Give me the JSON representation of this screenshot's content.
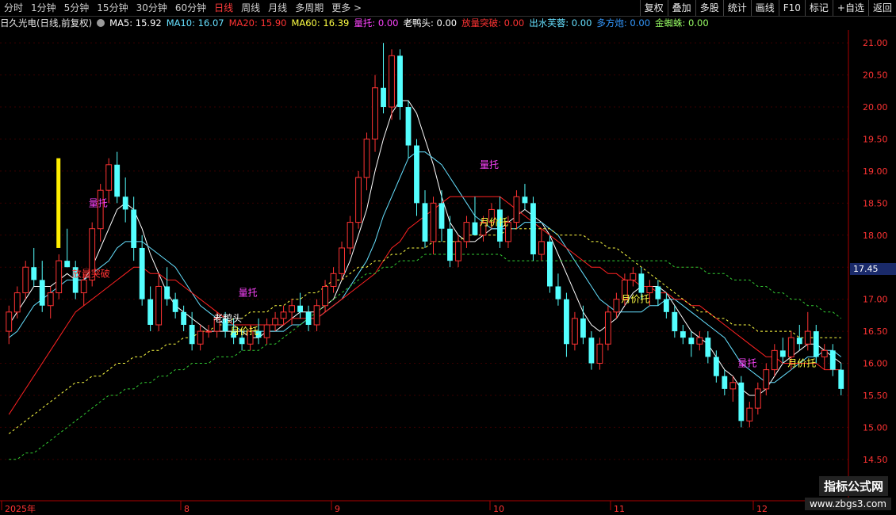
{
  "toolbar": {
    "periods": [
      "分时",
      "1分钟",
      "5分钟",
      "15分钟",
      "30分钟",
      "60分钟",
      "日线",
      "周线",
      "月线",
      "多周期",
      "更多 >"
    ],
    "active_period": "日线",
    "right_buttons": [
      "复权",
      "叠加",
      "多股",
      "统计",
      "画线",
      "F10",
      "标记",
      "+自选",
      "返回"
    ]
  },
  "info": {
    "stock": "日久光电(日线,前复权)",
    "ma5": "MA5: 15.92",
    "ma10": "MA10: 16.07",
    "ma20": "MA20: 15.90",
    "ma60": "MA60: 16.39",
    "i1": "量托: 0.00",
    "i2": "老鸭头: 0.00",
    "i3": "放量突破: 0.00",
    "i4": "出水芙蓉: 0.00",
    "i5": "多方炮: 0.00",
    "i6": "金蜘蛛: 0.00",
    "colors": {
      "ma5": "#ffffff",
      "ma10": "#66e0ff",
      "ma20": "#ff3333",
      "ma60": "#ffff44",
      "i1": "#ff44ff",
      "i2": "#ffffff",
      "i3": "#ff3333",
      "i4": "#66e0ff",
      "i5": "#3399ff",
      "i6": "#99ff66"
    }
  },
  "current_price": "17.45",
  "chart_data": {
    "type": "candlestick",
    "ylim": [
      14.3,
      21.2
    ],
    "yticks": [
      "21.00",
      "20.50",
      "20.00",
      "19.50",
      "19.00",
      "18.50",
      "18.00",
      "17.50",
      "17.00",
      "16.50",
      "16.00",
      "15.50",
      "15.00",
      "14.50"
    ],
    "x_labels": [
      "2025年",
      "8",
      "9",
      "10",
      "11",
      "12"
    ],
    "candles": [
      [
        16.5,
        16.9,
        16.3,
        16.8
      ],
      [
        16.8,
        17.2,
        16.7,
        17.1
      ],
      [
        17.1,
        17.6,
        17.0,
        17.5
      ],
      [
        17.5,
        17.8,
        17.2,
        17.3
      ],
      [
        17.3,
        17.6,
        16.8,
        16.9
      ],
      [
        16.9,
        17.2,
        16.7,
        17.1
      ],
      [
        17.1,
        17.7,
        17.0,
        17.6
      ],
      [
        17.6,
        18.1,
        17.5,
        17.5
      ],
      [
        17.5,
        17.6,
        17.0,
        17.1
      ],
      [
        17.1,
        17.4,
        16.9,
        17.3
      ],
      [
        17.3,
        18.2,
        17.2,
        18.1
      ],
      [
        18.1,
        18.8,
        17.9,
        18.7
      ],
      [
        18.7,
        19.2,
        18.5,
        19.1
      ],
      [
        19.1,
        19.3,
        18.5,
        18.6
      ],
      [
        18.6,
        18.9,
        18.2,
        18.4
      ],
      [
        18.4,
        18.6,
        17.6,
        17.8
      ],
      [
        17.8,
        18.0,
        16.9,
        17.0
      ],
      [
        17.0,
        17.2,
        16.5,
        16.6
      ],
      [
        16.6,
        17.4,
        16.5,
        17.2
      ],
      [
        17.2,
        17.5,
        16.9,
        17.0
      ],
      [
        17.0,
        17.1,
        16.7,
        16.8
      ],
      [
        16.8,
        16.9,
        16.5,
        16.6
      ],
      [
        16.6,
        16.8,
        16.2,
        16.3
      ],
      [
        16.3,
        16.6,
        16.2,
        16.5
      ],
      [
        16.5,
        16.6,
        16.4,
        16.5
      ],
      [
        16.5,
        16.8,
        16.4,
        16.7
      ],
      [
        16.7,
        16.8,
        16.4,
        16.5
      ],
      [
        16.5,
        16.7,
        16.3,
        16.4
      ],
      [
        16.4,
        16.5,
        16.2,
        16.3
      ],
      [
        16.3,
        16.6,
        16.2,
        16.5
      ],
      [
        16.5,
        16.7,
        16.3,
        16.4
      ],
      [
        16.4,
        16.7,
        16.3,
        16.6
      ],
      [
        16.6,
        16.8,
        16.5,
        16.7
      ],
      [
        16.7,
        16.9,
        16.6,
        16.8
      ],
      [
        16.8,
        17.0,
        16.6,
        16.9
      ],
      [
        16.9,
        17.1,
        16.7,
        16.8
      ],
      [
        16.8,
        16.9,
        16.5,
        16.6
      ],
      [
        16.6,
        17.0,
        16.5,
        16.9
      ],
      [
        16.9,
        17.3,
        16.8,
        17.2
      ],
      [
        17.2,
        17.5,
        17.1,
        17.4
      ],
      [
        17.4,
        17.9,
        17.3,
        17.8
      ],
      [
        17.8,
        18.3,
        17.7,
        18.2
      ],
      [
        18.2,
        19.0,
        18.1,
        18.9
      ],
      [
        18.9,
        19.6,
        18.7,
        19.5
      ],
      [
        19.5,
        20.5,
        19.3,
        20.3
      ],
      [
        20.3,
        21.0,
        19.9,
        20.0
      ],
      [
        20.0,
        20.9,
        19.8,
        20.8
      ],
      [
        20.8,
        20.9,
        19.8,
        20.0
      ],
      [
        20.0,
        20.1,
        19.2,
        19.4
      ],
      [
        19.4,
        19.5,
        18.3,
        18.5
      ],
      [
        18.5,
        18.7,
        17.8,
        17.9
      ],
      [
        17.9,
        18.6,
        17.7,
        18.5
      ],
      [
        18.5,
        18.7,
        17.9,
        18.1
      ],
      [
        18.1,
        18.3,
        17.5,
        17.6
      ],
      [
        17.6,
        18.0,
        17.5,
        17.9
      ],
      [
        17.9,
        18.3,
        17.8,
        18.2
      ],
      [
        18.2,
        18.6,
        18.0,
        18.0
      ],
      [
        18.0,
        18.3,
        17.9,
        18.2
      ],
      [
        18.2,
        18.5,
        18.1,
        18.4
      ],
      [
        18.4,
        18.6,
        17.8,
        17.9
      ],
      [
        17.9,
        18.3,
        17.8,
        18.2
      ],
      [
        18.2,
        18.7,
        18.1,
        18.6
      ],
      [
        18.6,
        18.8,
        18.4,
        18.5
      ],
      [
        18.5,
        18.6,
        17.6,
        17.7
      ],
      [
        17.7,
        18.1,
        17.6,
        17.9
      ],
      [
        17.9,
        18.0,
        17.1,
        17.2
      ],
      [
        17.2,
        17.4,
        16.9,
        17.0
      ],
      [
        17.0,
        17.1,
        16.1,
        16.3
      ],
      [
        16.3,
        16.8,
        16.2,
        16.7
      ],
      [
        16.7,
        16.9,
        16.3,
        16.4
      ],
      [
        16.4,
        16.5,
        15.9,
        16.0
      ],
      [
        16.0,
        16.4,
        15.9,
        16.3
      ],
      [
        16.3,
        16.9,
        16.2,
        16.8
      ],
      [
        16.8,
        17.1,
        16.7,
        17.0
      ],
      [
        17.0,
        17.4,
        16.9,
        17.3
      ],
      [
        17.3,
        17.5,
        17.2,
        17.4
      ],
      [
        17.4,
        17.5,
        17.0,
        17.1
      ],
      [
        17.1,
        17.3,
        16.9,
        17.2
      ],
      [
        17.2,
        17.3,
        16.9,
        17.0
      ],
      [
        17.0,
        17.1,
        16.7,
        16.8
      ],
      [
        16.8,
        16.9,
        16.4,
        16.5
      ],
      [
        16.5,
        16.6,
        16.3,
        16.4
      ],
      [
        16.4,
        16.5,
        16.1,
        16.3
      ],
      [
        16.3,
        16.5,
        16.2,
        16.4
      ],
      [
        16.4,
        16.5,
        16.0,
        16.1
      ],
      [
        16.1,
        16.2,
        15.7,
        15.8
      ],
      [
        15.8,
        15.9,
        15.5,
        15.6
      ],
      [
        15.6,
        15.8,
        15.4,
        15.7
      ],
      [
        15.7,
        15.8,
        15.0,
        15.1
      ],
      [
        15.1,
        15.4,
        15.0,
        15.3
      ],
      [
        15.3,
        15.7,
        15.2,
        15.6
      ],
      [
        15.6,
        16.0,
        15.5,
        15.9
      ],
      [
        15.9,
        16.3,
        15.8,
        16.2
      ],
      [
        16.2,
        16.4,
        16.0,
        16.1
      ],
      [
        16.1,
        16.5,
        15.9,
        16.4
      ],
      [
        16.4,
        16.6,
        16.2,
        16.3
      ],
      [
        16.3,
        16.8,
        16.2,
        16.5
      ],
      [
        16.5,
        16.6,
        16.0,
        16.1
      ],
      [
        16.1,
        16.3,
        15.9,
        16.2
      ],
      [
        16.2,
        16.3,
        15.8,
        15.9
      ],
      [
        15.9,
        16.0,
        15.5,
        15.6
      ]
    ],
    "ma_lines": {
      "ma5": [
        16.6,
        16.8,
        17.0,
        17.2,
        17.2,
        17.2,
        17.3,
        17.4,
        17.3,
        17.3,
        17.5,
        17.8,
        18.1,
        18.4,
        18.5,
        18.4,
        18.1,
        17.7,
        17.4,
        17.1,
        16.9,
        16.8,
        16.7,
        16.6,
        16.5,
        16.5,
        16.5,
        16.5,
        16.5,
        16.4,
        16.4,
        16.5,
        16.5,
        16.6,
        16.7,
        16.8,
        16.8,
        16.8,
        16.9,
        17.0,
        17.3,
        17.6,
        18.0,
        18.4,
        19.0,
        19.5,
        19.9,
        20.1,
        20.1,
        19.9,
        19.5,
        19.1,
        18.6,
        18.2,
        18.0,
        17.9,
        17.9,
        18.0,
        18.1,
        18.1,
        18.2,
        18.3,
        18.4,
        18.3,
        18.2,
        18.0,
        17.7,
        17.4,
        17.1,
        16.8,
        16.6,
        16.5,
        16.6,
        16.7,
        16.9,
        17.1,
        17.2,
        17.2,
        17.2,
        17.1,
        16.9,
        16.7,
        16.5,
        16.4,
        16.3,
        16.1,
        15.9,
        15.8,
        15.6,
        15.5,
        15.5,
        15.6,
        15.8,
        16.0,
        16.1,
        16.2,
        16.3,
        16.3,
        16.2,
        16.1,
        16.0
      ],
      "ma10": [
        16.4,
        16.5,
        16.7,
        16.9,
        17.0,
        17.1,
        17.2,
        17.3,
        17.3,
        17.3,
        17.4,
        17.5,
        17.6,
        17.8,
        17.9,
        17.9,
        17.9,
        17.8,
        17.7,
        17.6,
        17.5,
        17.3,
        17.1,
        16.9,
        16.8,
        16.7,
        16.6,
        16.6,
        16.5,
        16.5,
        16.5,
        16.5,
        16.5,
        16.5,
        16.6,
        16.6,
        16.7,
        16.7,
        16.8,
        16.9,
        17.0,
        17.2,
        17.4,
        17.6,
        17.9,
        18.3,
        18.6,
        18.9,
        19.2,
        19.3,
        19.3,
        19.2,
        19.1,
        18.9,
        18.7,
        18.5,
        18.3,
        18.2,
        18.1,
        18.1,
        18.1,
        18.1,
        18.2,
        18.2,
        18.2,
        18.1,
        18.0,
        17.8,
        17.6,
        17.4,
        17.2,
        17.0,
        16.9,
        16.8,
        16.8,
        16.8,
        16.8,
        16.9,
        16.9,
        17.0,
        17.0,
        16.9,
        16.8,
        16.7,
        16.6,
        16.5,
        16.4,
        16.2,
        16.0,
        15.9,
        15.8,
        15.7,
        15.7,
        15.8,
        15.9,
        16.0,
        16.1,
        16.1,
        16.2,
        16.2,
        16.1
      ],
      "ma20": [
        15.2,
        15.4,
        15.6,
        15.8,
        16.0,
        16.2,
        16.4,
        16.6,
        16.8,
        16.9,
        17.0,
        17.1,
        17.2,
        17.3,
        17.4,
        17.5,
        17.5,
        17.4,
        17.4,
        17.3,
        17.3,
        17.2,
        17.1,
        17.0,
        16.9,
        16.8,
        16.7,
        16.6,
        16.6,
        16.6,
        16.6,
        16.6,
        16.6,
        16.6,
        16.7,
        16.7,
        16.7,
        16.7,
        16.8,
        16.9,
        17.0,
        17.1,
        17.2,
        17.3,
        17.4,
        17.6,
        17.8,
        17.9,
        18.1,
        18.2,
        18.3,
        18.4,
        18.5,
        18.6,
        18.6,
        18.6,
        18.6,
        18.6,
        18.6,
        18.6,
        18.5,
        18.4,
        18.3,
        18.2,
        18.1,
        18.0,
        17.9,
        17.8,
        17.7,
        17.6,
        17.5,
        17.5,
        17.4,
        17.4,
        17.3,
        17.3,
        17.2,
        17.2,
        17.1,
        17.1,
        17.0,
        17.0,
        16.9,
        16.9,
        16.8,
        16.7,
        16.6,
        16.5,
        16.4,
        16.3,
        16.2,
        16.1,
        16.1,
        16.0,
        16.0,
        16.0,
        16.0,
        16.0,
        15.9,
        15.9,
        15.9
      ],
      "ma30": [
        14.9,
        15.0,
        15.1,
        15.2,
        15.3,
        15.4,
        15.5,
        15.6,
        15.7,
        15.7,
        15.8,
        15.8,
        15.9,
        16.0,
        16.0,
        16.1,
        16.1,
        16.2,
        16.2,
        16.3,
        16.3,
        16.4,
        16.4,
        16.5,
        16.5,
        16.6,
        16.6,
        16.7,
        16.7,
        16.8,
        16.8,
        16.8,
        16.9,
        16.9,
        17.0,
        17.0,
        17.1,
        17.1,
        17.2,
        17.3,
        17.3,
        17.4,
        17.5,
        17.5,
        17.6,
        17.6,
        17.7,
        17.7,
        17.8,
        17.8,
        17.8,
        17.9,
        17.9,
        17.9,
        17.9,
        18.0,
        18.0,
        18.0,
        18.0,
        18.0,
        18.1,
        18.1,
        18.1,
        18.1,
        18.1,
        18.1,
        18.0,
        18.0,
        18.0,
        18.0,
        17.9,
        17.9,
        17.8,
        17.8,
        17.7,
        17.6,
        17.5,
        17.4,
        17.3,
        17.2,
        17.1,
        17.0,
        16.9,
        16.8,
        16.8,
        16.7,
        16.7,
        16.6,
        16.6,
        16.6,
        16.5,
        16.5,
        16.5,
        16.5,
        16.5,
        16.4,
        16.4,
        16.4,
        16.4,
        16.4,
        16.4
      ],
      "ma60": [
        14.5,
        14.5,
        14.6,
        14.6,
        14.7,
        14.8,
        14.9,
        15.0,
        15.1,
        15.2,
        15.3,
        15.4,
        15.5,
        15.5,
        15.6,
        15.6,
        15.7,
        15.7,
        15.8,
        15.8,
        15.9,
        15.9,
        16.0,
        16.0,
        16.0,
        16.1,
        16.1,
        16.1,
        16.2,
        16.2,
        16.2,
        16.3,
        16.3,
        16.4,
        16.5,
        16.6,
        16.7,
        16.8,
        16.9,
        17.0,
        17.1,
        17.2,
        17.3,
        17.4,
        17.4,
        17.5,
        17.5,
        17.6,
        17.6,
        17.6,
        17.7,
        17.7,
        17.7,
        17.7,
        17.7,
        17.7,
        17.7,
        17.7,
        17.7,
        17.7,
        17.6,
        17.6,
        17.6,
        17.6,
        17.6,
        17.6,
        17.6,
        17.6,
        17.6,
        17.6,
        17.6,
        17.6,
        17.6,
        17.6,
        17.6,
        17.6,
        17.6,
        17.6,
        17.6,
        17.6,
        17.5,
        17.5,
        17.5,
        17.5,
        17.4,
        17.4,
        17.4,
        17.3,
        17.3,
        17.3,
        17.2,
        17.2,
        17.1,
        17.1,
        17.0,
        17.0,
        16.9,
        16.9,
        16.8,
        16.8,
        16.7
      ]
    },
    "markers": [
      {
        "text": "量托",
        "color": "#ff44ff"
      },
      {
        "text": "放量突破",
        "color": "#ff3333"
      },
      {
        "text": "量托",
        "color": "#ff44ff"
      },
      {
        "text": "老鸭头",
        "color": "#ffffff"
      },
      {
        "text": "月价托",
        "color": "#ffff44"
      },
      {
        "text": "量托",
        "color": "#ff44ff"
      },
      {
        "text": "月价托",
        "color": "#ffff44"
      },
      {
        "text": "月价托",
        "color": "#ffff44"
      },
      {
        "text": "量托",
        "color": "#ff44ff"
      },
      {
        "text": "月价托",
        "color": "#ffff44"
      }
    ]
  },
  "watermark": {
    "title": "指标公式网",
    "url": "www.zbgs3.com"
  }
}
